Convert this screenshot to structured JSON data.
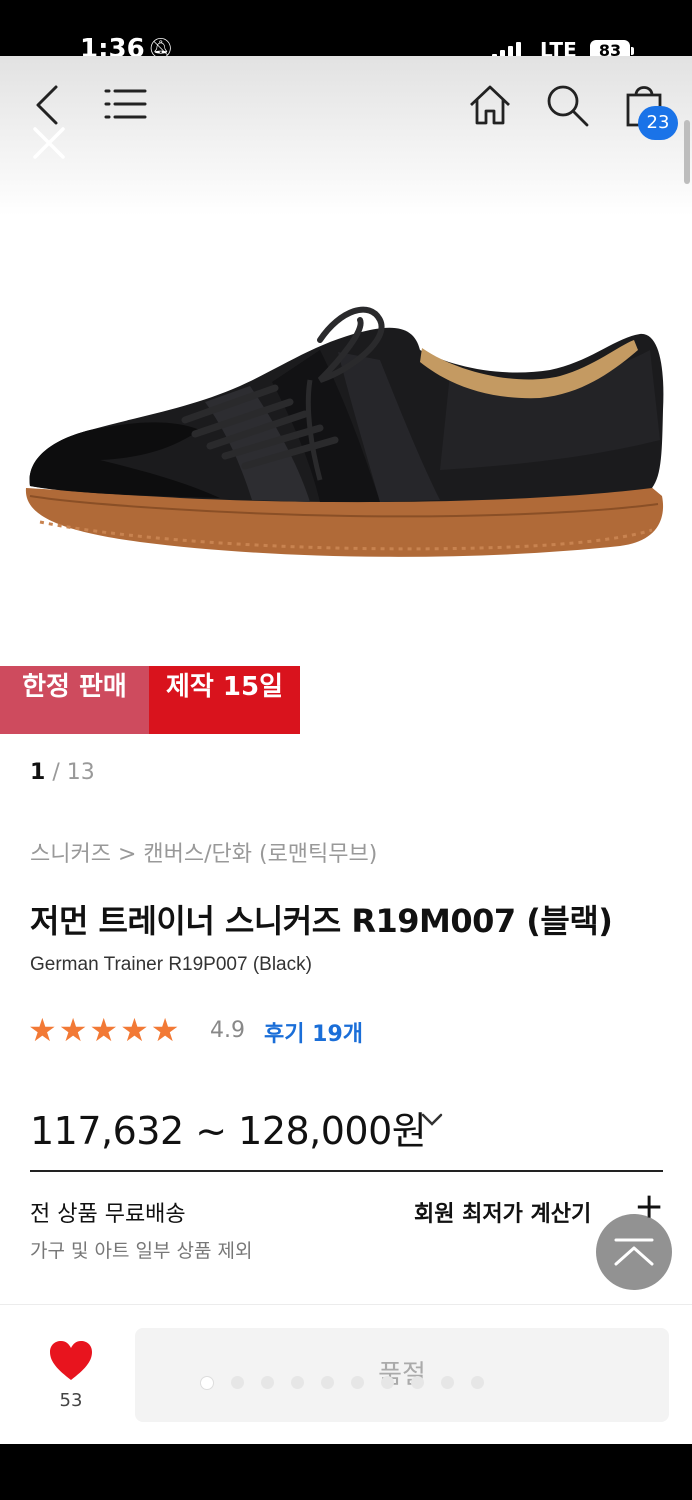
{
  "status_bar": {
    "time": "1:36",
    "network": "LTE",
    "battery": "83"
  },
  "nav": {
    "back_icon": "chevron-left-icon",
    "menu_icon": "hamburger-icon",
    "close_icon": "close-icon",
    "home_icon": "home-icon",
    "search_icon": "search-icon",
    "cart_icon": "shopping-bag-icon",
    "cart_count": "23"
  },
  "product": {
    "image_icon": "sneaker-image",
    "tags": {
      "limited": "한정 판매",
      "production": "제작 15일"
    },
    "image_counter": {
      "current": "1",
      "separator": "/",
      "total": "13"
    },
    "breadcrumb": "스니커즈 > 캔버스/단화 (로맨틱무브)",
    "title": "저먼 트레이너 스니커즈 R19M007 (블랙)",
    "subtitle": "German Trainer R19P007 (Black)",
    "rating": {
      "stars": 5,
      "score": "4.9",
      "reviews_label": "후기 19개"
    },
    "price": "117,632 ~ 128,000원",
    "shipping": {
      "title": "전 상품 무료배송",
      "note": "가구 및 아트 일부 상품 제외"
    },
    "member_price_calc": "회원 최저가 계산기"
  },
  "bottom_bar": {
    "like_count": "53",
    "soldout_label": "품절",
    "dots_total": 10,
    "dots_active": 1
  },
  "colors": {
    "tag_limited": "#ce4b5e",
    "tag_production": "#d9131d",
    "star": "#f27935",
    "review_link": "#1a6ed8",
    "cart_badge": "#1a73e8",
    "heart": "#e8141e"
  }
}
